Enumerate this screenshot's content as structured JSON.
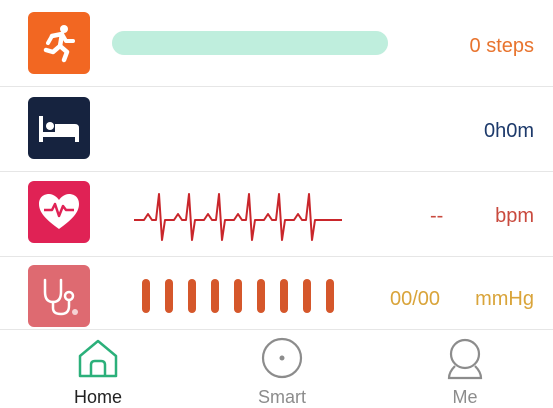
{
  "metrics": {
    "steps": {
      "icon": "running-person-icon",
      "value": "0 steps",
      "progress": 1.0,
      "color": "#f26722",
      "bar_color": "#bfeedd"
    },
    "sleep": {
      "icon": "bed-icon",
      "value": "0h0m",
      "color": "#16233f"
    },
    "heart_rate": {
      "icon": "heart-pulse-icon",
      "value": "--",
      "unit": "bpm",
      "color": "#e02255",
      "wave_color": "#c9262b"
    },
    "blood_pressure": {
      "icon": "stethoscope-icon",
      "value": "00/00",
      "unit": "mmHg",
      "color": "#de6a71",
      "bars": 9,
      "bar_color": "#d5572b",
      "text_color": "#d9a43a"
    }
  },
  "nav": {
    "active_color": "#2bb07a",
    "inactive_color": "#8c8c8c",
    "items": [
      {
        "label": "Home",
        "icon": "home-icon",
        "active": true
      },
      {
        "label": "Smart",
        "icon": "smart-circle-icon",
        "active": false
      },
      {
        "label": "Me",
        "icon": "person-icon",
        "active": false
      }
    ]
  }
}
